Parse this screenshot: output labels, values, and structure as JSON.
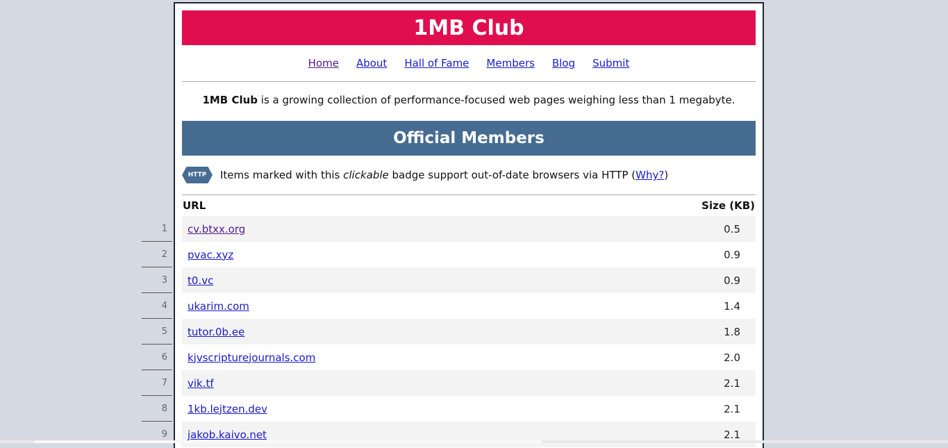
{
  "site": {
    "title": "1MB Club",
    "colors": {
      "banner": "#e00e4f",
      "section": "#476c91",
      "link": "#1a1acc",
      "visited": "#551a8b"
    }
  },
  "nav": [
    {
      "label": "Home"
    },
    {
      "label": "About"
    },
    {
      "label": "Hall of Fame"
    },
    {
      "label": "Members"
    },
    {
      "label": "Blog"
    },
    {
      "label": "Submit"
    }
  ],
  "intro": {
    "brand": "1MB Club",
    "text": " is a growing collection of performance-focused web pages weighing less than 1 megabyte."
  },
  "section": {
    "title": "Official Members",
    "badge_label": "HTTP",
    "badge_icon": "http-badge-icon",
    "note_before": "Items marked with this ",
    "note_em": "clickable",
    "note_after": " badge support out-of-date browsers via HTTP (",
    "why_link": "Why?",
    "note_close": ")"
  },
  "table": {
    "headers": {
      "url": "URL",
      "size": "Size (KB)"
    },
    "rows": [
      {
        "n": "1",
        "url": "cv.btxx.org",
        "size": "0.5"
      },
      {
        "n": "2",
        "url": "pvac.xyz",
        "size": "0.9"
      },
      {
        "n": "3",
        "url": "t0.vc",
        "size": "0.9"
      },
      {
        "n": "4",
        "url": "ukarim.com",
        "size": "1.4"
      },
      {
        "n": "5",
        "url": "tutor.0b.ee",
        "size": "1.8"
      },
      {
        "n": "6",
        "url": "kjvscripturejournals.com",
        "size": "2.0"
      },
      {
        "n": "7",
        "url": "vik.tf",
        "size": "2.1"
      },
      {
        "n": "8",
        "url": "1kb.lejtzen.dev",
        "size": "2.1"
      },
      {
        "n": "9",
        "url": "jakob.kaivo.net",
        "size": "2.1"
      }
    ]
  }
}
